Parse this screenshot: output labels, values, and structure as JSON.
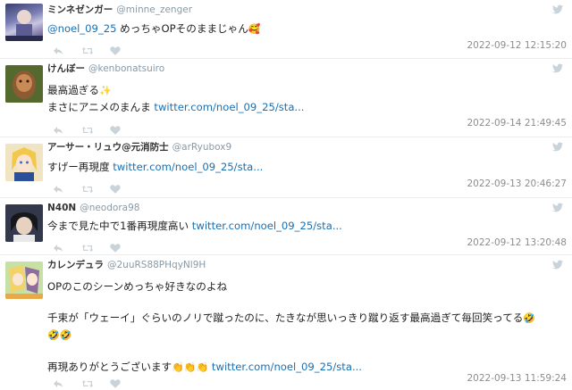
{
  "colors": {
    "link": "#1b6fb1",
    "muted": "#8899a6",
    "icon": "#c8d3da"
  },
  "tweets": [
    {
      "name": "ミンネゼンガー",
      "handle": "@minne_zenger",
      "lines": [
        {
          "mention": "@noel_09_25",
          "text": " めっちゃOPそのままじゃん",
          "emoji": "🥰"
        }
      ],
      "timestamp": "2022-09-12 12:15:20"
    },
    {
      "name": "けんぼー",
      "handle": "@kenbonatsuiro",
      "lines": [
        {
          "text": "最高過ぎる",
          "emoji": "✨"
        },
        {
          "text": "まさにアニメのまんま ",
          "link": "twitter.com/noel_09_25/sta..."
        }
      ],
      "timestamp": "2022-09-14 21:49:45"
    },
    {
      "name": "アーサー・リュウ@元消防士",
      "handle": "@arRyubox9",
      "lines": [
        {
          "text": "すげー再現度 ",
          "link": "twitter.com/noel_09_25/sta..."
        }
      ],
      "timestamp": "2022-09-13 20:46:27"
    },
    {
      "name": "N40N",
      "handle": "@neodora98",
      "lines": [
        {
          "text": "今まで見た中で1番再現度高い ",
          "link": "twitter.com/noel_09_25/sta..."
        }
      ],
      "timestamp": "2022-09-12 13:20:48"
    },
    {
      "name": "カレンデュラ",
      "handle": "@2uuRS88PHqyNl9H",
      "lines": [
        {
          "text": "OPのこのシーンめっちゃ好きなのよね"
        },
        {
          "text": "千束が「ウェーイ」ぐらいのノリで蹴ったのに、たきなが思いっきり蹴り返す最高過ぎて毎回笑ってる",
          "emoji": "🤣"
        },
        {
          "emoji": "🤣🤣"
        },
        {
          "text": "再現ありがとうございます",
          "emoji": "👏👏👏",
          "link": " twitter.com/noel_09_25/sta..."
        }
      ],
      "timestamp": "2022-09-13 11:59:24"
    }
  ]
}
